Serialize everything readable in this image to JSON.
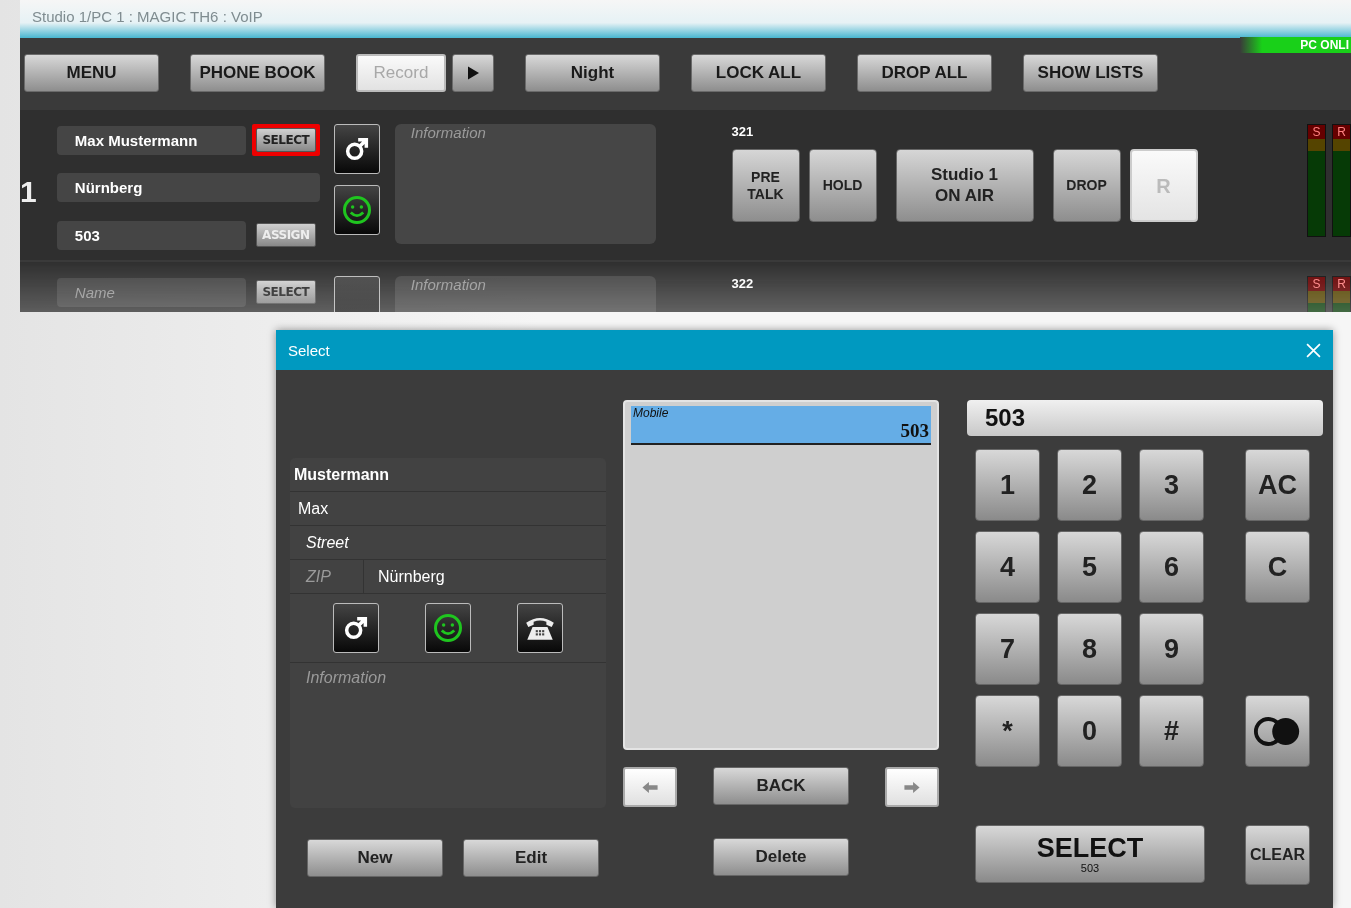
{
  "window": {
    "title": "Studio 1/PC 1 : MAGIC TH6 : VoIP",
    "status": "PC ONLI"
  },
  "toolbar": [
    {
      "kind": "button",
      "label": "MENU"
    },
    {
      "kind": "button",
      "label": "PHONE BOOK"
    },
    {
      "kind": "light",
      "label": "Record"
    },
    {
      "kind": "play"
    },
    {
      "kind": "button",
      "label": "Night"
    },
    {
      "kind": "button",
      "label": "LOCK ALL"
    },
    {
      "kind": "button",
      "label": "DROP ALL"
    },
    {
      "kind": "button",
      "label": "SHOW LISTS"
    }
  ],
  "lines": [
    {
      "number": "1",
      "name": "Max Mustermann",
      "city": "Nürnberg",
      "phone": "503",
      "select_button": "SELECT",
      "select_highlighted": true,
      "assign_button": "ASSIGN",
      "info_placeholder": "Information",
      "line_id": "321",
      "buttons": [
        {
          "kind": "button",
          "label": "PRE\nTALK"
        },
        {
          "kind": "button",
          "label": "HOLD"
        },
        {
          "kind": "wide",
          "label": "Studio 1\nON AIR"
        },
        {
          "kind": "button",
          "label": "DROP"
        },
        {
          "kind": "light",
          "label": "R"
        }
      ],
      "meters": [
        "S",
        "R"
      ]
    },
    {
      "name_placeholder": "Name",
      "select_button": "SELECT",
      "select_highlighted": false,
      "info_placeholder": "Information",
      "line_id": "322",
      "meters": [
        "S",
        "R"
      ]
    }
  ],
  "dialog": {
    "title": "Select",
    "contact": {
      "last_name": "Mustermann",
      "first_name": "Max",
      "street_placeholder": "Street",
      "zip_placeholder": "ZIP",
      "city": "Nürnberg",
      "info_placeholder": "Information"
    },
    "numbers": [
      {
        "label": "Mobile",
        "number": "503",
        "selected": true
      }
    ],
    "nav": {
      "back": "BACK"
    },
    "buttons": [
      "New",
      "Edit",
      "Delete"
    ],
    "display": "503",
    "digits": [
      "1",
      "2",
      "3",
      "4",
      "5",
      "6",
      "7",
      "8",
      "9",
      "*",
      "0",
      "#"
    ],
    "side_keys": [
      {
        "kind": "text",
        "label": "AC"
      },
      {
        "kind": "text",
        "label": "C"
      },
      {
        "kind": "toggle"
      }
    ],
    "select": {
      "label": "SELECT",
      "number": "503"
    },
    "clear": "CLEAR"
  }
}
